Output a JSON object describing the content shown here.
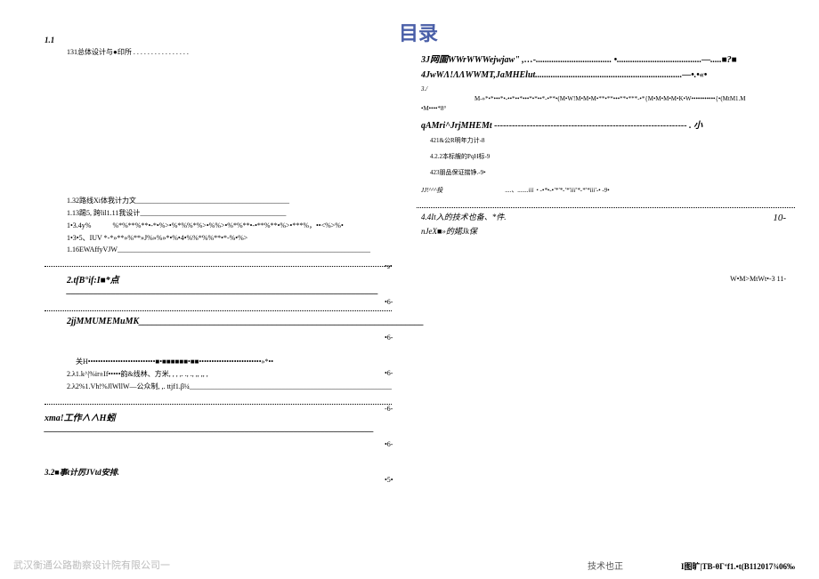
{
  "left": {
    "sec11": "1.1",
    "item131": "131总体设计与●印所 . . . . . . . . . . . . . . . .",
    "item132": "1.32路线Xi体我计力文___________________________________________",
    "item113": "1.13踢5, 跨lil1.11我设计_________________________________________",
    "item134y": "1•3.4y%　　　%*%**%**•-*•%>•%*%%*%>•%%>•%*%**•-•**%**•%>•***%，••<%>%•",
    "item135": "1•3•5、IUV *-*»**»%**»J%»%»*•%•4•%%*%%**•*-%•%>",
    "item116": "1.16EWAffyVJW_______________________________________________________________________",
    "item2": "2.tfB°if:I■*点______________________________________________________________________",
    "item2jj": "2jjMMUMEMuMK________________________________________________________________",
    "itemGH": "关H•••••••••••••••••••••••••••■•■■■■■■•■■•••••••••••••••••••••••••»*••",
    "item2l1": "2.λ1.k^|%ir±If•••••韵&线林、方米, , , ,. ., ., ,, ,, ,",
    "item2l2": "2.λ2%1.Vh!%JlWllW—公众制, ,. ttjf1.β¼______________________________________________________________",
    "itemXmat": "xma!工作∧∧H蚓__________________________________________________________________________",
    "item32": "3.2■事t计厉JVtd安排.",
    "side": {
      "a": "•s•",
      "b": "•6-",
      "c": "•6-",
      "d": "•6-",
      "e": "-6-",
      "f": "•6-",
      "g": "•5•"
    }
  },
  "right": {
    "title": "目录",
    "item3j": "3J网圄WWrWWWejwjaw\" ,…-.................................. •......................................—.....■?■",
    "item4jw": "4JwWΛ!ΛΛWWMT,JaMHElut..................................................................—•.•«•",
    "item3l": "3./",
    "itemM": "M-»*•*•••*•-••*••*•••*•*••*-•**•(M•W!M•M•M•**•**•••**•***-•*{M•M•M•M•K•W•••••••••••{•(MtM1.M",
    "itemM8": "•M••••*8°",
    "itemQA": "qAMri^JrjMHEMt ----------------------------------------------------------------- . 小",
    "item421": "421&公R明年力计-8",
    "item422": "4.2.2本标艘的PqH标-9",
    "item423": "423朋品保证揣铮.-9•",
    "itemJJ": "JJ!^^^投　　　　　　　　　　....、.......iii・-•*•-•'*'*-'*'iii'*-*'*iii'-• -9•",
    "item44": "4.4It入的技术也备、*件.",
    "itemNJ": "nJeX■»的婼Jk保",
    "page10": "10-",
    "itemWM": "W•M>MtWt•-3 11-"
  },
  "footer": {
    "company": "武汉衡通公路勘察设计院有限公司一",
    "tech": "技术也正",
    "code": "I图旷|TB-θΓʻf1.•t(B112017¾06‰"
  }
}
